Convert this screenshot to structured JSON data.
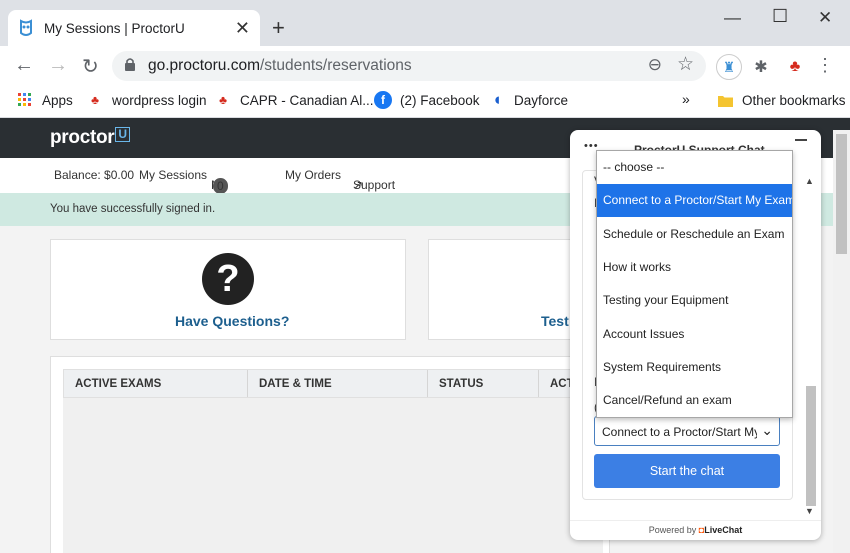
{
  "browser": {
    "tab_title": "My Sessions | ProctorU",
    "url_host": "go.proctoru.com",
    "url_path": "/students/reservations",
    "bookmarks": [
      {
        "label": "Apps",
        "icon": "apps-grid-icon"
      },
      {
        "label": "wordpress login",
        "icon": "canada-maple-icon"
      },
      {
        "label": "CAPR - Canadian Al...",
        "icon": "canada-maple-icon"
      },
      {
        "label": "(2) Facebook",
        "icon": "facebook-icon"
      },
      {
        "label": "Dayforce",
        "icon": "dayforce-icon"
      }
    ],
    "other_bookmarks": "Other bookmarks"
  },
  "site": {
    "logo_text": "proctor",
    "logo_u": "U",
    "balance": "Balance: $0.00",
    "nav": [
      "My Sessions",
      "My Cart",
      "My Orders",
      "Support"
    ],
    "cart_count": "0",
    "alert": "You have successfully signed in.",
    "card_questions": "Have Questions?",
    "card_test": "Test",
    "table_headers": [
      "ACTIVE EXAMS",
      "DATE & TIME",
      "STATUS",
      "ACT"
    ]
  },
  "chat": {
    "title": "ProctorU Support Chat",
    "select_value": "Connect to a Proctor/Start My Exam",
    "start_button": "Start the chat",
    "powered_by": "Powered by",
    "brand": "LiveChat",
    "options": [
      "-- choose --",
      "Connect to a Proctor/Start My Exam",
      "Schedule or Reschedule an Exam",
      "How it works",
      "Testing your Equipment",
      "Account Issues",
      "System Requirements",
      "Cancel/Refund an exam"
    ],
    "selected_index": 1
  },
  "colors": {
    "accent": "#3c7fe4",
    "nav_dark": "#2a2f33",
    "alert_bg": "#cfe9e1",
    "link": "#1d5f8e"
  }
}
